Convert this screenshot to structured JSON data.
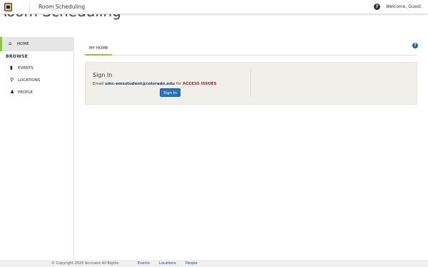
{
  "background_title": "Room Scheduling",
  "topbar": {
    "app_title": "Room Scheduling",
    "welcome": "Welcome, Guest.",
    "help_glyph": "?"
  },
  "sidebar": {
    "home": {
      "icon": "home-icon",
      "label": "HOME"
    },
    "browse_heading": "BROWSE",
    "items": [
      {
        "icon": "bookmark-icon",
        "label": "EVENTS"
      },
      {
        "icon": "map-marker-icon",
        "label": "LOCATIONS"
      },
      {
        "icon": "person-icon",
        "label": "PEOPLE"
      }
    ]
  },
  "main": {
    "tab_label": "MY HOME",
    "help_glyph": "?",
    "signin": {
      "title": "Sign In",
      "text_prefix": "Email",
      "email": "umc-emsstudent@colorado.edu",
      "text_mid": "for",
      "issues": "ACCESS ISSUES",
      "button_label": "Sign In"
    }
  },
  "footer": {
    "copyright": "© Copyright 2025 Accruent All Rights",
    "links": [
      "Events",
      "Locations",
      "People"
    ]
  },
  "colors": {
    "accent": "#8cc63f",
    "button": "#2a71c2",
    "warning": "#b31b1b",
    "panel_bg": "#f1efe9"
  }
}
